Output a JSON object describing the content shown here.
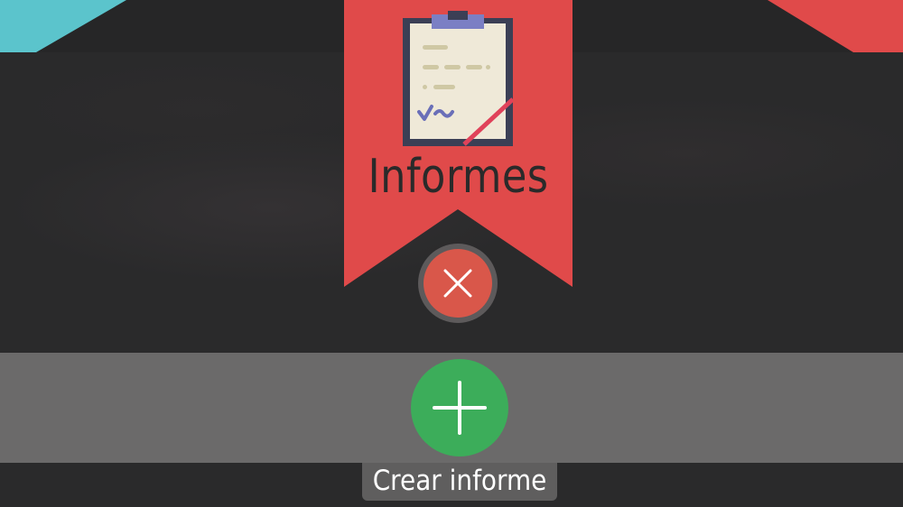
{
  "screen": {
    "title": "Informes",
    "icon": "clipboard-report-icon"
  },
  "actions": {
    "close": {
      "icon": "close-x-icon",
      "color": "#d9574a"
    },
    "create": {
      "icon": "plus-icon",
      "color": "#3cad5a",
      "label": "Crear informe"
    }
  },
  "colors": {
    "banner": "#e04a4a",
    "accent_left": "#5bc4cc",
    "accent_right": "#e04a4a",
    "background": "#2a2a2b",
    "action_bar": "#6b6a6a"
  }
}
